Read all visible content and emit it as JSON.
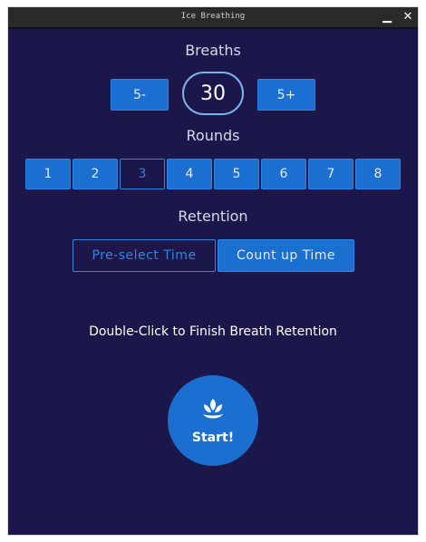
{
  "window": {
    "title": "Ice Breathing",
    "minimize_glyph": "▁",
    "close_glyph": "✕"
  },
  "breaths": {
    "heading": "Breaths",
    "minus_label": "5-",
    "value": "30",
    "plus_label": "5+"
  },
  "rounds": {
    "heading": "Rounds",
    "options": [
      "1",
      "2",
      "3",
      "4",
      "5",
      "6",
      "7",
      "8"
    ],
    "selected": "3"
  },
  "retention": {
    "heading": "Retention",
    "preselect_label": "Pre-select Time",
    "countup_label": "Count up Time",
    "selected": "Pre-select Time"
  },
  "hint": "Double-Click to Finish Breath Retention",
  "start": {
    "label": "Start!",
    "icon": "lotus-icon"
  },
  "colors": {
    "background": "#1b174b",
    "button": "#1a6fd0",
    "selected_outline": "#2f86e3",
    "breath_ring": "#7ab3ea"
  }
}
